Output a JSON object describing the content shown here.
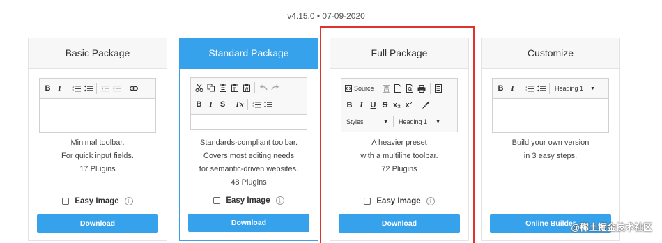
{
  "version": "v4.15.0 • 07-09-2020",
  "cards": {
    "basic": {
      "title": "Basic Package",
      "desc": [
        "Minimal toolbar.",
        "For quick input fields.",
        "17 Plugins"
      ],
      "easy_image": "Easy Image",
      "button": "Download"
    },
    "standard": {
      "title": "Standard Package",
      "desc": [
        "Standards-compliant toolbar.",
        "Covers most editing needs",
        "for semantic-driven websites.",
        "48 Plugins"
      ],
      "easy_image": "Easy Image",
      "button": "Download"
    },
    "full": {
      "title": "Full Package",
      "desc": [
        "A heavier preset",
        "with a multiline toolbar.",
        "72 Plugins"
      ],
      "easy_image": "Easy Image",
      "button": "Download",
      "source_label": "Source",
      "styles_label": "Styles",
      "heading_label": "Heading 1"
    },
    "custom": {
      "title": "Customize",
      "desc": [
        "Build your own version",
        "in 3 easy steps."
      ],
      "heading_label": "Heading 1",
      "button": "Online Builder"
    }
  },
  "toolbar": {
    "bold": "B",
    "italic": "I",
    "underline": "U",
    "strike": "S",
    "clear_format": "Tx",
    "subscript": "x₂",
    "superscript": "x²"
  },
  "info_glyph": "i",
  "watermark": "@稀土掘金技术社区",
  "colors": {
    "accent": "#36a2eb",
    "highlight": "#e0332d"
  }
}
